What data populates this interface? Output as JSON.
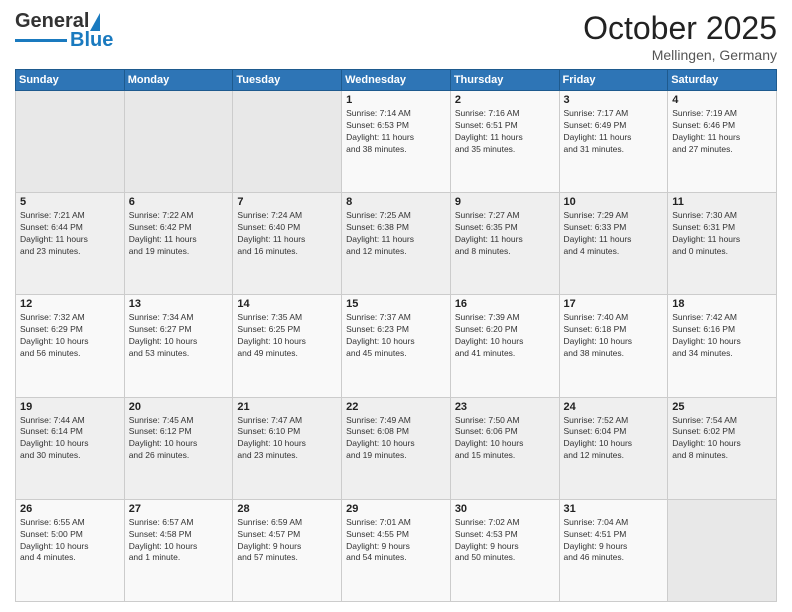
{
  "header": {
    "logo_general": "General",
    "logo_blue": "Blue",
    "title": "October 2025",
    "subtitle": "Mellingen, Germany"
  },
  "days_of_week": [
    "Sunday",
    "Monday",
    "Tuesday",
    "Wednesday",
    "Thursday",
    "Friday",
    "Saturday"
  ],
  "weeks": [
    [
      {
        "day": "",
        "info": ""
      },
      {
        "day": "",
        "info": ""
      },
      {
        "day": "",
        "info": ""
      },
      {
        "day": "1",
        "info": "Sunrise: 7:14 AM\nSunset: 6:53 PM\nDaylight: 11 hours\nand 38 minutes."
      },
      {
        "day": "2",
        "info": "Sunrise: 7:16 AM\nSunset: 6:51 PM\nDaylight: 11 hours\nand 35 minutes."
      },
      {
        "day": "3",
        "info": "Sunrise: 7:17 AM\nSunset: 6:49 PM\nDaylight: 11 hours\nand 31 minutes."
      },
      {
        "day": "4",
        "info": "Sunrise: 7:19 AM\nSunset: 6:46 PM\nDaylight: 11 hours\nand 27 minutes."
      }
    ],
    [
      {
        "day": "5",
        "info": "Sunrise: 7:21 AM\nSunset: 6:44 PM\nDaylight: 11 hours\nand 23 minutes."
      },
      {
        "day": "6",
        "info": "Sunrise: 7:22 AM\nSunset: 6:42 PM\nDaylight: 11 hours\nand 19 minutes."
      },
      {
        "day": "7",
        "info": "Sunrise: 7:24 AM\nSunset: 6:40 PM\nDaylight: 11 hours\nand 16 minutes."
      },
      {
        "day": "8",
        "info": "Sunrise: 7:25 AM\nSunset: 6:38 PM\nDaylight: 11 hours\nand 12 minutes."
      },
      {
        "day": "9",
        "info": "Sunrise: 7:27 AM\nSunset: 6:35 PM\nDaylight: 11 hours\nand 8 minutes."
      },
      {
        "day": "10",
        "info": "Sunrise: 7:29 AM\nSunset: 6:33 PM\nDaylight: 11 hours\nand 4 minutes."
      },
      {
        "day": "11",
        "info": "Sunrise: 7:30 AM\nSunset: 6:31 PM\nDaylight: 11 hours\nand 0 minutes."
      }
    ],
    [
      {
        "day": "12",
        "info": "Sunrise: 7:32 AM\nSunset: 6:29 PM\nDaylight: 10 hours\nand 56 minutes."
      },
      {
        "day": "13",
        "info": "Sunrise: 7:34 AM\nSunset: 6:27 PM\nDaylight: 10 hours\nand 53 minutes."
      },
      {
        "day": "14",
        "info": "Sunrise: 7:35 AM\nSunset: 6:25 PM\nDaylight: 10 hours\nand 49 minutes."
      },
      {
        "day": "15",
        "info": "Sunrise: 7:37 AM\nSunset: 6:23 PM\nDaylight: 10 hours\nand 45 minutes."
      },
      {
        "day": "16",
        "info": "Sunrise: 7:39 AM\nSunset: 6:20 PM\nDaylight: 10 hours\nand 41 minutes."
      },
      {
        "day": "17",
        "info": "Sunrise: 7:40 AM\nSunset: 6:18 PM\nDaylight: 10 hours\nand 38 minutes."
      },
      {
        "day": "18",
        "info": "Sunrise: 7:42 AM\nSunset: 6:16 PM\nDaylight: 10 hours\nand 34 minutes."
      }
    ],
    [
      {
        "day": "19",
        "info": "Sunrise: 7:44 AM\nSunset: 6:14 PM\nDaylight: 10 hours\nand 30 minutes."
      },
      {
        "day": "20",
        "info": "Sunrise: 7:45 AM\nSunset: 6:12 PM\nDaylight: 10 hours\nand 26 minutes."
      },
      {
        "day": "21",
        "info": "Sunrise: 7:47 AM\nSunset: 6:10 PM\nDaylight: 10 hours\nand 23 minutes."
      },
      {
        "day": "22",
        "info": "Sunrise: 7:49 AM\nSunset: 6:08 PM\nDaylight: 10 hours\nand 19 minutes."
      },
      {
        "day": "23",
        "info": "Sunrise: 7:50 AM\nSunset: 6:06 PM\nDaylight: 10 hours\nand 15 minutes."
      },
      {
        "day": "24",
        "info": "Sunrise: 7:52 AM\nSunset: 6:04 PM\nDaylight: 10 hours\nand 12 minutes."
      },
      {
        "day": "25",
        "info": "Sunrise: 7:54 AM\nSunset: 6:02 PM\nDaylight: 10 hours\nand 8 minutes."
      }
    ],
    [
      {
        "day": "26",
        "info": "Sunrise: 6:55 AM\nSunset: 5:00 PM\nDaylight: 10 hours\nand 4 minutes."
      },
      {
        "day": "27",
        "info": "Sunrise: 6:57 AM\nSunset: 4:58 PM\nDaylight: 10 hours\nand 1 minute."
      },
      {
        "day": "28",
        "info": "Sunrise: 6:59 AM\nSunset: 4:57 PM\nDaylight: 9 hours\nand 57 minutes."
      },
      {
        "day": "29",
        "info": "Sunrise: 7:01 AM\nSunset: 4:55 PM\nDaylight: 9 hours\nand 54 minutes."
      },
      {
        "day": "30",
        "info": "Sunrise: 7:02 AM\nSunset: 4:53 PM\nDaylight: 9 hours\nand 50 minutes."
      },
      {
        "day": "31",
        "info": "Sunrise: 7:04 AM\nSunset: 4:51 PM\nDaylight: 9 hours\nand 46 minutes."
      },
      {
        "day": "",
        "info": ""
      }
    ]
  ]
}
